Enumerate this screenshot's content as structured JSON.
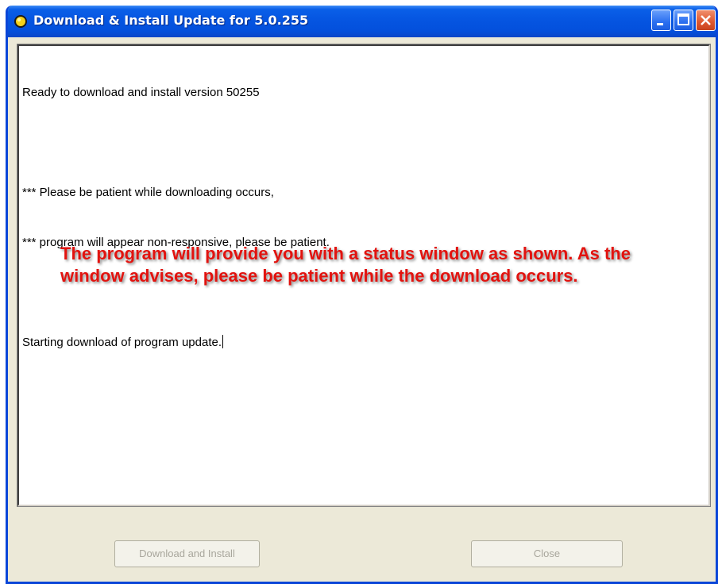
{
  "window": {
    "title": "Download & Install Update for 5.0.255"
  },
  "log": {
    "lines": [
      "Ready to download and install version 50255",
      "",
      "*** Please be patient while downloading occurs,",
      "*** program will appear non-responsive, please be patient.",
      "",
      "Starting download of program update."
    ]
  },
  "annotation": {
    "text": "The program will provide you with a status window as shown.  As the window advises, please be patient while the download occurs."
  },
  "buttons": {
    "download_label": "Download and Install",
    "close_label": "Close"
  },
  "icons": {
    "title_icon": "update-sun-icon",
    "minimize": "minimize-icon",
    "maximize": "maximize-icon",
    "close": "close-icon"
  },
  "colors": {
    "titlebar": "#0554e0",
    "annotation": "#e2130f",
    "close_button": "#e05a32",
    "disabled_text": "#a8a69c"
  }
}
